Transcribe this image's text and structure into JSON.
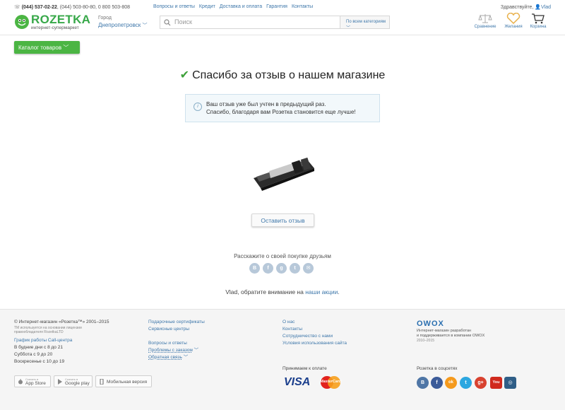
{
  "header": {
    "phone_main": "(044) 537-02-22",
    "phone_other": ", (044) 503-80-80, 0 800 503-808",
    "logo_text": "ROZETKA",
    "logo_sub": "интернет-супермаркет",
    "city_label": "Город",
    "city_value": "Днепропетровск",
    "nav": [
      "Вопросы и ответы",
      "Кредит",
      "Доставка и оплата",
      "Гарантия",
      "Контакты"
    ],
    "greeting": "Здравствуйте,",
    "user": "Vlad",
    "search_placeholder": "Поиск",
    "search_category": "По всем категориям",
    "icons": {
      "compare": "Сравнение",
      "wishlist": "Желания",
      "cart": "Корзина"
    }
  },
  "catalog_button": "Каталог товаров",
  "main": {
    "title": "Спасибо за отзыв о нашем магазине",
    "notice_line1": "Ваш отзыв уже был учтен в предыдущий раз.",
    "notice_line2": "Спасибо, благодаря вам Розетка становится еще лучше!",
    "review_button": "Оставить отзыв",
    "share_label": "Расскажите о своей покупке друзьям",
    "share_icons": [
      "vk-icon",
      "facebook-icon",
      "google-plus-icon",
      "twitter-icon",
      "email-icon"
    ],
    "attention_prefix": "Vlad, обратите внимание на ",
    "attention_link": "наши акции",
    "attention_suffix": "."
  },
  "footer": {
    "copyright": "© Интернет-магазин «Розетка™» 2001–2015",
    "tm_note_1": "TM используется на основании лицензии",
    "tm_note_2": "правообладателя RozetkaLTD",
    "callcenter_title": "График работы Call-центра",
    "schedule": [
      "В будние дни с 8 до 21",
      "Суббота с 9 до 20",
      "Воскресенье с 10 до 19"
    ],
    "col2_links_a": [
      "Подарочные сертификаты",
      "Сервисные центры"
    ],
    "col2_links_b": [
      "Вопросы и ответы",
      "Проблемы с заказом",
      "Обратная связь"
    ],
    "col3_links": [
      "О нас",
      "Контакты",
      "Сотрудничество с нами",
      "Условия использования сайта"
    ],
    "payment_label": "Принимаем к оплате",
    "visa": "VISA",
    "mastercard": "MasterCard",
    "owox": "OWOX",
    "owox_text_1": "Интернет-магазин разработан",
    "owox_text_2": "и поддерживается в компании OWOX",
    "owox_years": "2010–2015",
    "social_label": "Розетка в соцсетях",
    "appstore_small": "Скачать в",
    "appstore": "App Store",
    "googleplay_small": "Скачать в",
    "googleplay": "Google play",
    "mobile": "Мобильная версия",
    "social_icons": [
      "vk-icon",
      "facebook-icon",
      "odnoklassniki-icon",
      "twitter-icon",
      "google-plus-icon",
      "youtube-icon",
      "instagram-icon"
    ],
    "social_glyphs": [
      "В",
      "f",
      "ok",
      "t",
      "g+",
      "You",
      "◎"
    ]
  },
  "colors": {
    "brand_green": "#37a849",
    "link_blue": "#3e77aa",
    "button_green": "#4bb543"
  }
}
